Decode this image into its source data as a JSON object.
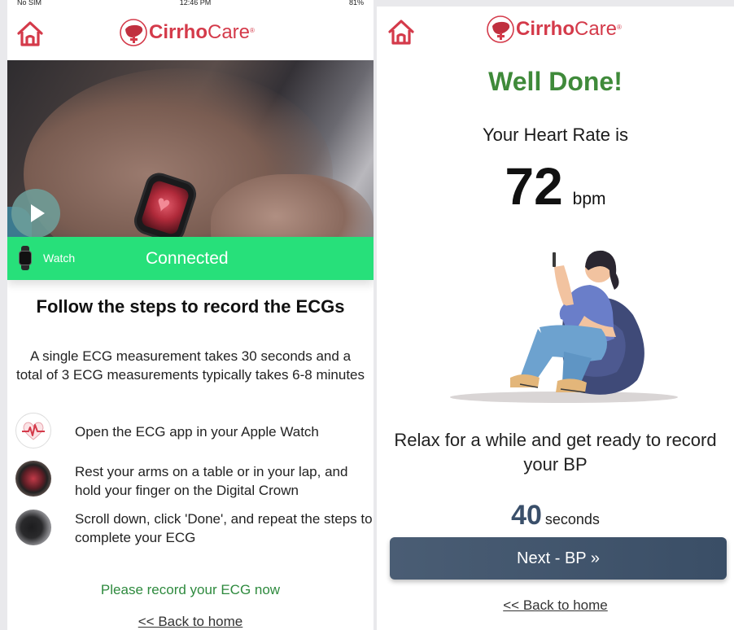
{
  "left_screen": {
    "status": {
      "carrier": "No SIM",
      "time": "12:46 PM",
      "battery": "81%"
    },
    "logo": {
      "bold": "Cirrho",
      "light": "Care",
      "mark": "®"
    },
    "connection": {
      "device_label": "Watch",
      "status_text": "Connected"
    },
    "steps_title": "Follow the steps to record the ECGs",
    "steps_description": "A single ECG measurement takes 30 seconds and a total of 3 ECG measurements typically takes 6-8 minutes",
    "steps": [
      {
        "icon": "ecg-heart-icon",
        "text": "Open the ECG app in your Apple Watch"
      },
      {
        "icon": "watch-photo-icon",
        "text": "Rest your arms on a table or in your lap, and hold your finger on the Digital Crown"
      },
      {
        "icon": "watch-done-photo-icon",
        "text": "Scroll down, click 'Done', and repeat the steps to complete your ECG"
      }
    ],
    "prompt": "Please record your ECG now",
    "back_link": "<< Back to home"
  },
  "right_screen": {
    "logo": {
      "bold": "Cirrho",
      "light": "Care",
      "mark": "®"
    },
    "heading": "Well Done!",
    "heart_rate_label": "Your Heart Rate is",
    "heart_rate_value": "72",
    "heart_rate_unit": "bpm",
    "relax_text": "Relax for a while and get ready to record your BP",
    "countdown_value": "40",
    "countdown_unit": "seconds",
    "next_button": "Next - BP »",
    "back_link": "<< Back to home"
  },
  "colors": {
    "brand_red": "#d43a4a",
    "connected_green": "#27e07a",
    "success_green": "#3f8a3a",
    "prompt_green": "#2e8a3e",
    "button_navy": "#3a4e66"
  }
}
